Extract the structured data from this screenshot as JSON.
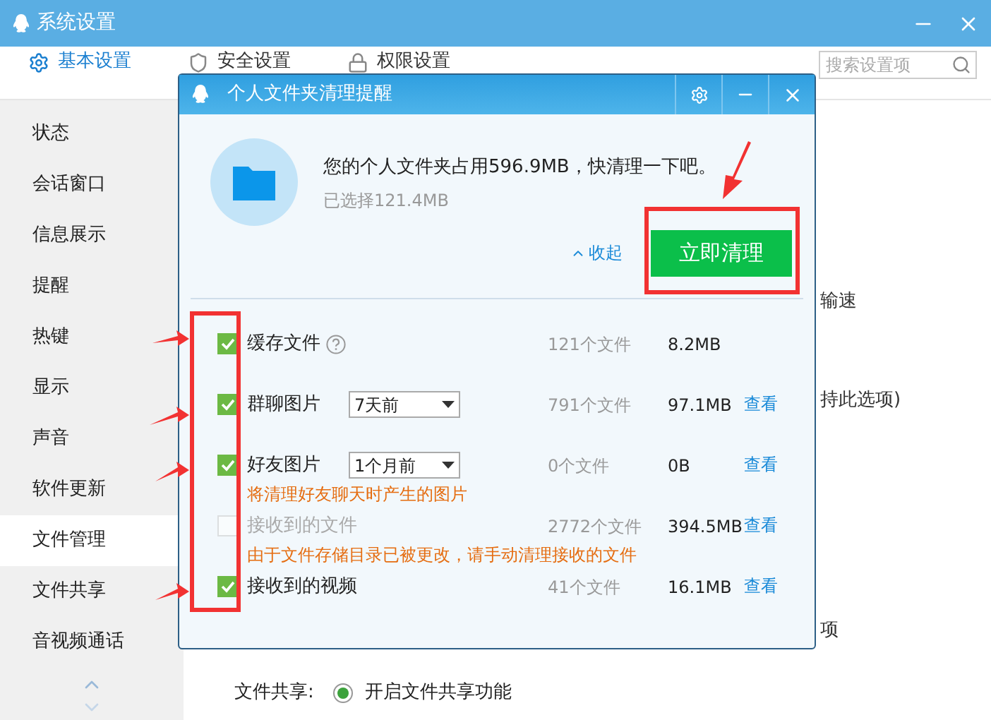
{
  "window": {
    "title": "系统设置"
  },
  "tabs": [
    {
      "label": "基本设置",
      "selected": true
    },
    {
      "label": "安全设置",
      "selected": false
    },
    {
      "label": "权限设置",
      "selected": false
    }
  ],
  "search": {
    "placeholder": "搜索设置项"
  },
  "sidebar": {
    "items": [
      {
        "label": "状态",
        "selected": false
      },
      {
        "label": "会话窗口",
        "selected": false
      },
      {
        "label": "信息展示",
        "selected": false
      },
      {
        "label": "提醒",
        "selected": false
      },
      {
        "label": "热键",
        "selected": false
      },
      {
        "label": "显示",
        "selected": false
      },
      {
        "label": "声音",
        "selected": false
      },
      {
        "label": "软件更新",
        "selected": false
      },
      {
        "label": "文件管理",
        "selected": true
      },
      {
        "label": "文件共享",
        "selected": false
      },
      {
        "label": "音视频通话",
        "selected": false
      }
    ]
  },
  "background": {
    "fragments": [
      "输速",
      "持此选项)",
      "项"
    ],
    "file_sharing": {
      "label": "文件共享:",
      "option": "开启文件共享功能",
      "checked": true
    }
  },
  "dialog": {
    "title": "个人文件夹清理提醒",
    "message": "您的个人文件夹占用596.9MB，快清理一下吧。",
    "selected_size": "已选择121.4MB",
    "collapse": "收起",
    "clean_button": "立即清理",
    "rows": [
      {
        "label": "缓存文件",
        "checked": true,
        "disabled": false,
        "help": true,
        "count": "121个文件",
        "size": "8.2MB"
      },
      {
        "label": "群聊图片",
        "checked": true,
        "disabled": false,
        "dropdown": "7天前",
        "count": "791个文件",
        "size": "97.1MB",
        "link": "查看"
      },
      {
        "label": "好友图片",
        "checked": true,
        "disabled": false,
        "dropdown": "1个月前",
        "count": "0个文件",
        "size": "0B",
        "link": "查看",
        "note": "将清理好友聊天时产生的图片"
      },
      {
        "label": "接收到的文件",
        "checked": false,
        "disabled": true,
        "count": "2772个文件",
        "size": "394.5MB",
        "link": "查看",
        "note": "由于文件存储目录已被更改，请手动清理接收的文件"
      },
      {
        "label": "接收到的视频",
        "checked": true,
        "disabled": false,
        "count": "41个文件",
        "size": "16.1MB",
        "link": "查看"
      }
    ]
  }
}
